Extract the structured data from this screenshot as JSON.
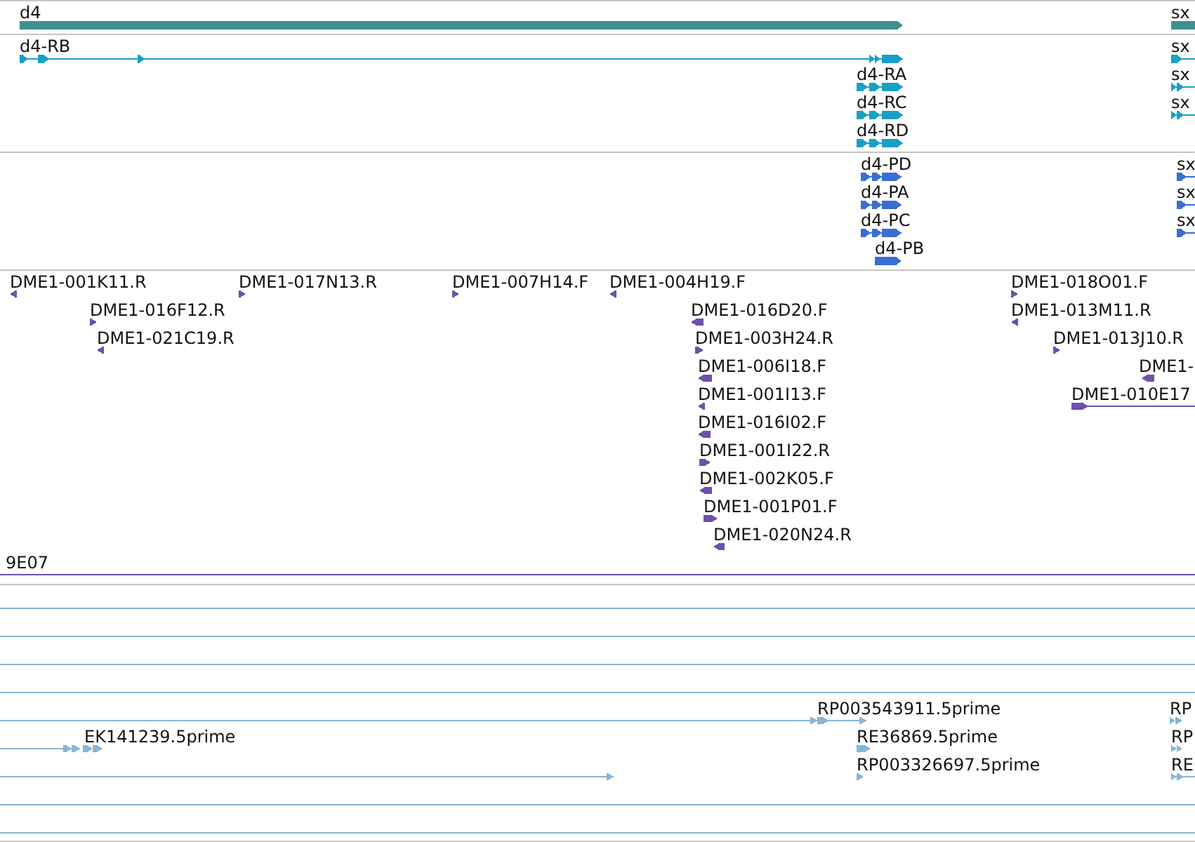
{
  "tracks": [
    {
      "color": "#408f91",
      "features": [
        {
          "kind": "gene",
          "label": "d4",
          "reverse": false
        },
        {
          "kind": "gene",
          "label": "sx"
        }
      ]
    },
    {
      "color": "#19a0c4",
      "features": [
        {
          "kind": "transcript",
          "label": "d4-RB",
          "reverse": false
        },
        {
          "kind": "transcript",
          "label": "sx",
          "reverse": false
        },
        {
          "kind": "transcript",
          "label": "d4-RA",
          "reverse": false
        },
        {
          "kind": "transcript",
          "label": "sx",
          "reverse": false
        },
        {
          "kind": "transcript",
          "label": "d4-RC",
          "reverse": false
        },
        {
          "kind": "transcript",
          "label": "sx",
          "reverse": false
        },
        {
          "kind": "transcript",
          "label": "d4-RD",
          "reverse": false
        }
      ]
    },
    {
      "color": "#3a6fd2",
      "features": [
        {
          "kind": "protein",
          "label": "d4-PD",
          "reverse": false
        },
        {
          "kind": "protein",
          "label": "sx",
          "reverse": false
        },
        {
          "kind": "protein",
          "label": "d4-PA",
          "reverse": false
        },
        {
          "kind": "protein",
          "label": "sx",
          "reverse": false
        },
        {
          "kind": "protein",
          "label": "d4-PC",
          "reverse": false
        },
        {
          "kind": "protein",
          "label": "sx",
          "reverse": false
        },
        {
          "kind": "protein",
          "label": "d4-PB",
          "reverse": false
        }
      ]
    },
    {
      "color": "#7050aa",
      "features": [
        {
          "kind": "bac_end",
          "label": "DME1-001K11.R",
          "reverse": true
        },
        {
          "kind": "bac_end",
          "label": "DME1-017N13.R",
          "reverse": false
        },
        {
          "kind": "bac_end",
          "label": "DME1-007H14.F",
          "reverse": false
        },
        {
          "kind": "bac_end",
          "label": "DME1-004H19.F",
          "reverse": true
        },
        {
          "kind": "bac_end",
          "label": "DME1-018O01.F",
          "reverse": false
        },
        {
          "kind": "bac_end",
          "label": "DME1-016F12.R",
          "reverse": false
        },
        {
          "kind": "bac_end",
          "label": "DME1-016D20.F",
          "reverse": true
        },
        {
          "kind": "bac_end",
          "label": "DME1-013M11.R",
          "reverse": true
        },
        {
          "kind": "bac_end",
          "label": "DME1-021C19.R",
          "reverse": true
        },
        {
          "kind": "bac_end",
          "label": "DME1-003H24.R",
          "reverse": false
        },
        {
          "kind": "bac_end",
          "label": "DME1-013J10.R",
          "reverse": false
        },
        {
          "kind": "bac_end",
          "label": "DME1-006I18.F",
          "reverse": true
        },
        {
          "kind": "bac_end",
          "label": "DME1-",
          "reverse": true
        },
        {
          "kind": "bac_end",
          "label": "DME1-001I13.F",
          "reverse": true
        },
        {
          "kind": "bac_end",
          "label": "DME1-010E17",
          "reverse": false
        },
        {
          "kind": "bac_end",
          "label": "DME1-016I02.F",
          "reverse": true
        },
        {
          "kind": "bac_end",
          "label": "DME1-001I22.R",
          "reverse": false
        },
        {
          "kind": "bac_end",
          "label": "DME1-002K05.F",
          "reverse": true
        },
        {
          "kind": "bac_end",
          "label": "DME1-001P01.F",
          "reverse": false
        },
        {
          "kind": "bac_end",
          "label": "DME1-020N24.R",
          "reverse": true
        },
        {
          "kind": "bac_end",
          "label": "9E07"
        }
      ]
    },
    {
      "color": "#86b6da",
      "features": [
        {
          "kind": "est"
        },
        {
          "kind": "est"
        },
        {
          "kind": "est"
        },
        {
          "kind": "est"
        },
        {
          "kind": "est",
          "reverse": false
        },
        {
          "kind": "est",
          "label": "RP003543911.5prime",
          "reverse": false
        },
        {
          "kind": "est",
          "label": "RP",
          "reverse": false
        },
        {
          "kind": "est",
          "reverse": false
        },
        {
          "kind": "est",
          "label": "EK141239.5prime",
          "reverse": false
        },
        {
          "kind": "est",
          "label": "RE36869.5prime",
          "reverse": false
        },
        {
          "kind": "est",
          "label": "RP",
          "reverse": false
        },
        {
          "kind": "est",
          "reverse": false
        },
        {
          "kind": "est",
          "label": "RP003326697.5prime",
          "reverse": false
        },
        {
          "kind": "est",
          "label": "RE",
          "reverse": false
        },
        {
          "kind": "est"
        },
        {
          "kind": "est"
        }
      ]
    }
  ]
}
